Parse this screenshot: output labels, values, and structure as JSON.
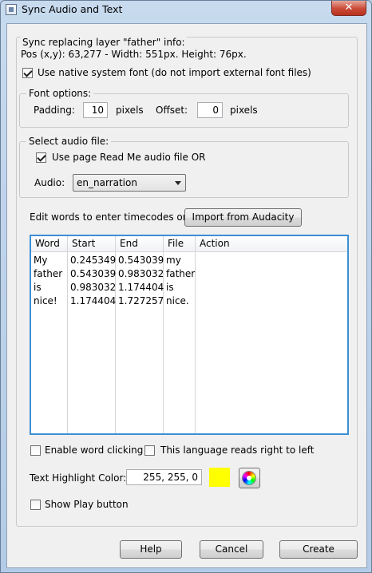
{
  "window": {
    "title": "Sync Audio and Text",
    "close_glyph": "✕"
  },
  "layer_info": {
    "heading": "Sync replacing layer \"father\" info:",
    "details": "Pos (x,y): 63,277 - Width: 551px. Height: 76px."
  },
  "native_font": {
    "label": "Use native system font (do not import external font files)",
    "checked": true
  },
  "font_options": {
    "legend": "Font options:",
    "padding_label": "Padding:",
    "padding_value": "10",
    "padding_unit": "pixels",
    "offset_label": "Offset:",
    "offset_value": "0",
    "offset_unit": "pixels"
  },
  "audio_file": {
    "legend": "Select audio file:",
    "use_page_label": "Use page Read Me audio file  OR",
    "use_page_checked": true,
    "audio_label": "Audio:",
    "audio_value": "en_narration"
  },
  "edit_words": {
    "label": "Edit words to enter timecodes or",
    "import_button": "Import from Audacity"
  },
  "table": {
    "headers": [
      "Word",
      "Start",
      "End",
      "File",
      "Action"
    ],
    "rows": [
      {
        "word": "My",
        "start": "0.245349",
        "end": "0.543039",
        "file": "my"
      },
      {
        "word": "father",
        "start": "0.543039",
        "end": "0.983032",
        "file": "father"
      },
      {
        "word": "is",
        "start": "0.983032",
        "end": "1.174404",
        "file": "is"
      },
      {
        "word": "nice!",
        "start": "1.174404",
        "end": "1.727257",
        "file": "nice."
      }
    ]
  },
  "options": {
    "enable_word_clicking": "Enable word clicking",
    "rtl": "This language reads right to left",
    "highlight_label": "Text Highlight Color:",
    "highlight_value": "255, 255, 0",
    "highlight_color": "#ffff00",
    "show_play": "Show Play button"
  },
  "buttons": {
    "help": "Help",
    "cancel": "Cancel",
    "create": "Create"
  }
}
